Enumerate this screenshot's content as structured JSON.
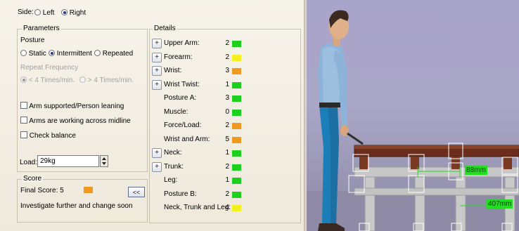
{
  "side": {
    "label": "Side:",
    "options": [
      {
        "label": "Left",
        "checked": false
      },
      {
        "label": "Right",
        "checked": true
      }
    ]
  },
  "parameters": {
    "title": "Parameters",
    "posture_label": "Posture",
    "posture_options": [
      {
        "label": "Static",
        "checked": false
      },
      {
        "label": "Intermittent",
        "checked": true
      },
      {
        "label": "Repeated",
        "checked": false
      }
    ],
    "repeat_label": "Repeat Frequency",
    "repeat_options": [
      {
        "label": "< 4 Times/min.",
        "checked": true
      },
      {
        "label": "> 4 Times/min.",
        "checked": false
      }
    ],
    "checkboxes": [
      {
        "label": "Arm supported/Person leaning",
        "checked": false
      },
      {
        "label": "Arms are working across midline",
        "checked": false
      },
      {
        "label": "Check balance",
        "checked": false
      }
    ],
    "load_label": "Load:",
    "load_value": "29kg"
  },
  "score": {
    "title": "Score",
    "final_label": "Final Score: 5",
    "final_color": "#ef9a1e",
    "collapse_label": "<<",
    "message": "Investigate further and change soon"
  },
  "details": {
    "title": "Details",
    "rows": [
      {
        "label": "Upper Arm:",
        "value": "2",
        "color": "#1ecf1e",
        "expand": true
      },
      {
        "label": "Forearm:",
        "value": "2",
        "color": "#f2f01e",
        "expand": true
      },
      {
        "label": "Wrist:",
        "value": "3",
        "color": "#ef9a1e",
        "expand": true
      },
      {
        "label": "Wrist Twist:",
        "value": "1",
        "color": "#1ecf1e",
        "expand": true
      },
      {
        "label": "Posture A:",
        "value": "3",
        "color": "#1ecf1e",
        "expand": false
      },
      {
        "label": "Muscle:",
        "value": "0",
        "color": "#1ecf1e",
        "expand": false
      },
      {
        "label": "Force/Load:",
        "value": "2",
        "color": "#ef9a1e",
        "expand": false
      },
      {
        "label": "Wrist and Arm:",
        "value": "5",
        "color": "#ef9a1e",
        "expand": false
      },
      {
        "label": "Neck:",
        "value": "1",
        "color": "#1ecf1e",
        "expand": true
      },
      {
        "label": "Trunk:",
        "value": "2",
        "color": "#1ecf1e",
        "expand": true
      },
      {
        "label": "Leg:",
        "value": "1",
        "color": "#1ecf1e",
        "expand": false
      },
      {
        "label": "Posture B:",
        "value": "2",
        "color": "#1ecf1e",
        "expand": false
      },
      {
        "label": "Neck, Trunk and Leg:",
        "value": "4",
        "color": "#f2f01e",
        "expand": false
      }
    ]
  },
  "viewport": {
    "dimension_1": "88mm",
    "dimension_2": "407mm",
    "dimension_color": "#22dd22"
  }
}
